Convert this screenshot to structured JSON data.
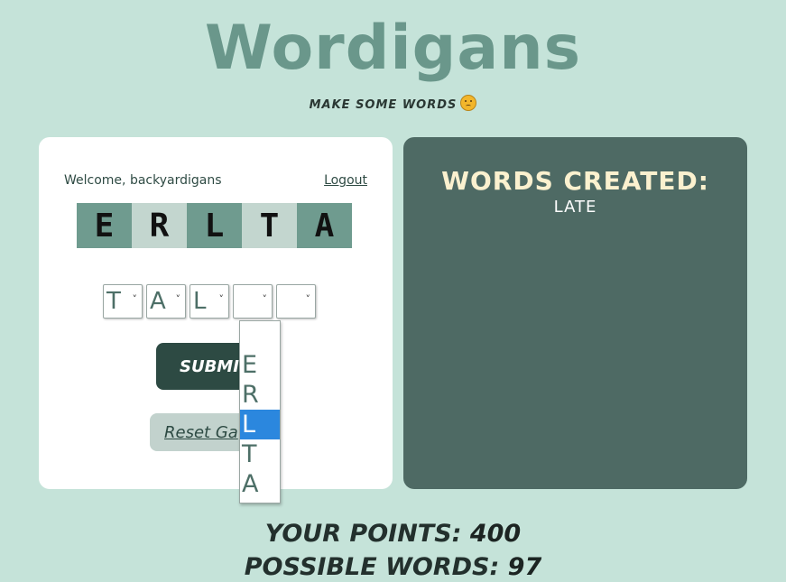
{
  "header": {
    "title": "Wordigans",
    "tagline": "MAKE SOME WORDS",
    "tagline_icon": "thinking-face-emoji"
  },
  "game": {
    "welcome": "Welcome, backyardigans",
    "logout": "Logout",
    "letters": [
      "E",
      "R",
      "L",
      "T",
      "A"
    ],
    "tile_colors": [
      "#6f9b8f",
      "#c3d6cf",
      "#6f9b8f",
      "#c3d6cf",
      "#6f9b8f"
    ],
    "selects": [
      {
        "value": "T",
        "chevron": "˅"
      },
      {
        "value": "A",
        "chevron": "˅"
      },
      {
        "value": "L",
        "chevron": "˅"
      },
      {
        "value": "",
        "chevron": "˅"
      },
      {
        "value": "",
        "chevron": "˅"
      }
    ],
    "dropdown_options": [
      "",
      "E",
      "R",
      "L",
      "T",
      "A"
    ],
    "dropdown_selected": "L",
    "submit_label": "SUBMI",
    "reset_label": "Reset Ga"
  },
  "words_panel": {
    "title": "WORDS CREATED:",
    "words": [
      "LATE"
    ]
  },
  "stats": {
    "points_label": "YOUR POINTS:",
    "points_value": "400",
    "possible_label": "POSSIBLE WORDS:",
    "possible_value": "97"
  },
  "colors": {
    "background": "#c5e3d9",
    "title": "#6a978b",
    "panel": "#4e6a64",
    "submit": "#2d4a43",
    "highlight": "#2b87de"
  }
}
